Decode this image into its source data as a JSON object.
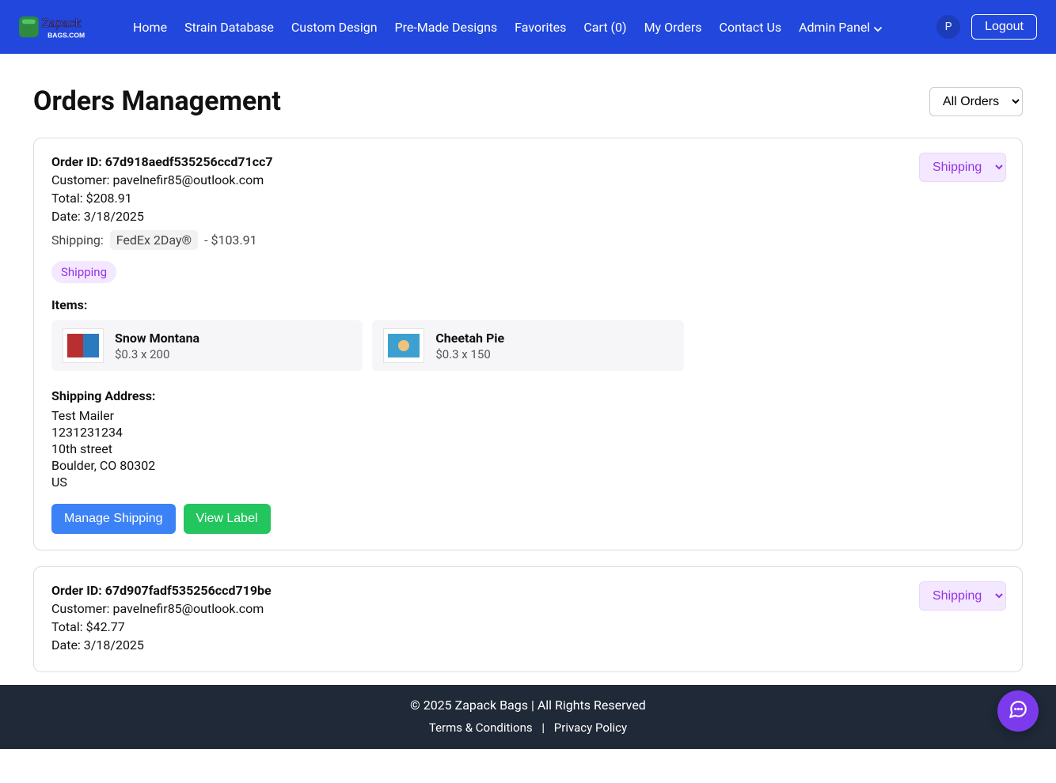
{
  "nav": {
    "items": [
      "Home",
      "Strain Database",
      "Custom Design",
      "Pre-Made Designs",
      "Favorites",
      "Cart (0)",
      "My Orders",
      "Contact Us"
    ],
    "admin_panel": "Admin Panel",
    "avatar_initial": "P",
    "logout": "Logout"
  },
  "page": {
    "title": "Orders Management",
    "filter_selected": "All Orders"
  },
  "labels": {
    "order_id": "Order ID:",
    "customer": "Customer:",
    "total": "Total:",
    "date": "Date:",
    "shipping": "Shipping:",
    "items": "Items:",
    "shipping_address": "Shipping Address:",
    "manage_shipping": "Manage Shipping",
    "view_label": "View Label"
  },
  "orders": [
    {
      "id": "67d918aedf535256ccd71cc7",
      "customer": "pavelnefir85@outlook.com",
      "total": "$208.91",
      "date": "3/18/2025",
      "shipping_method": "FedEx 2Day®",
      "shipping_cost": "- $103.91",
      "status": "Shipping",
      "status_select": "Shipping",
      "items": [
        {
          "name": "Snow Montana",
          "price_line": "$0.3 x 200"
        },
        {
          "name": "Cheetah Pie",
          "price_line": "$0.3 x 150"
        }
      ],
      "address": {
        "name": "Test Mailer",
        "phone": "1231231234",
        "street": "10th street",
        "city_state_zip": "Boulder, CO 80302",
        "country": "US"
      }
    },
    {
      "id": "67d907fadf535256ccd719be",
      "customer": "pavelnefir85@outlook.com",
      "total": "$42.77",
      "date": "3/18/2025",
      "status_select": "Shipping"
    }
  ],
  "footer": {
    "copyright": "© 2025 Zapack Bags | All Rights Reserved",
    "terms": "Terms & Conditions",
    "privacy": "Privacy Policy",
    "sep": "|"
  }
}
